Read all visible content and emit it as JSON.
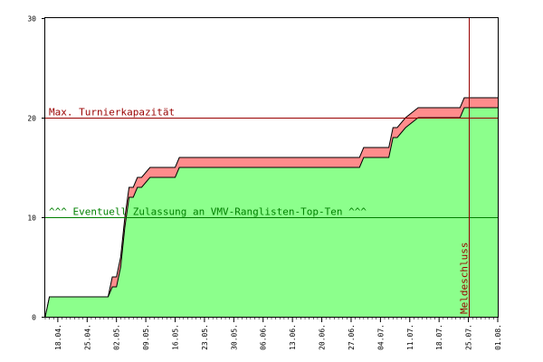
{
  "chart_data": {
    "type": "area",
    "title": "",
    "xlabel": "",
    "ylabel": "",
    "ylim": [
      0,
      30
    ],
    "yticks": [
      0,
      10,
      20,
      30
    ],
    "x_start": "2024-04-15",
    "x_end": "2024-08-01",
    "xticks": [
      "18.04.",
      "25.04.",
      "02.05.",
      "09.05.",
      "16.05.",
      "23.05.",
      "30.05.",
      "06.06.",
      "13.06.",
      "20.06.",
      "27.06.",
      "04.07.",
      "11.07.",
      "18.07.",
      "25.07.",
      "01.08."
    ],
    "series": [
      {
        "color": "#8cff8c",
        "x": [
          "2024-04-15",
          "2024-04-16",
          "2024-04-17",
          "2024-04-30",
          "2024-05-01",
          "2024-05-02",
          "2024-05-03",
          "2024-05-04",
          "2024-05-05",
          "2024-05-06",
          "2024-05-07",
          "2024-05-08",
          "2024-05-10",
          "2024-05-12",
          "2024-05-16",
          "2024-05-17",
          "2024-06-29",
          "2024-06-30",
          "2024-07-06",
          "2024-07-07",
          "2024-07-08",
          "2024-07-10",
          "2024-07-13",
          "2024-07-23",
          "2024-07-24",
          "2024-08-01"
        ],
        "values": [
          0,
          2,
          2,
          2,
          3,
          3,
          5,
          9,
          12,
          12,
          13,
          13,
          14,
          14,
          14,
          15,
          15,
          16,
          16,
          18,
          18,
          19,
          20,
          20,
          21,
          21
        ]
      },
      {
        "color": "#ff8c8c",
        "x": [
          "2024-04-15",
          "2024-04-16",
          "2024-04-17",
          "2024-04-30",
          "2024-05-01",
          "2024-05-02",
          "2024-05-03",
          "2024-05-04",
          "2024-05-05",
          "2024-05-06",
          "2024-05-07",
          "2024-05-08",
          "2024-05-10",
          "2024-05-12",
          "2024-05-16",
          "2024-05-17",
          "2024-06-29",
          "2024-06-30",
          "2024-07-06",
          "2024-07-07",
          "2024-07-08",
          "2024-07-10",
          "2024-07-13",
          "2024-07-23",
          "2024-07-24",
          "2024-08-01"
        ],
        "values": [
          0,
          2,
          2,
          2,
          4,
          4,
          6,
          10,
          13,
          13,
          14,
          14,
          15,
          15,
          15,
          16,
          16,
          17,
          17,
          19,
          19,
          20,
          21,
          21,
          22,
          22
        ]
      }
    ],
    "hlines": [
      {
        "y": 20,
        "label": "Max. Turnierkapazität",
        "color": "#990000"
      },
      {
        "y": 10,
        "label": "^^^ Eventuell Zulassung an VMV-Ranglisten-Top-Ten ^^^",
        "color": "#008000"
      }
    ],
    "vlines": [
      {
        "x": "2024-07-25",
        "label": "Meldeschluss",
        "color": "#990000"
      }
    ]
  }
}
